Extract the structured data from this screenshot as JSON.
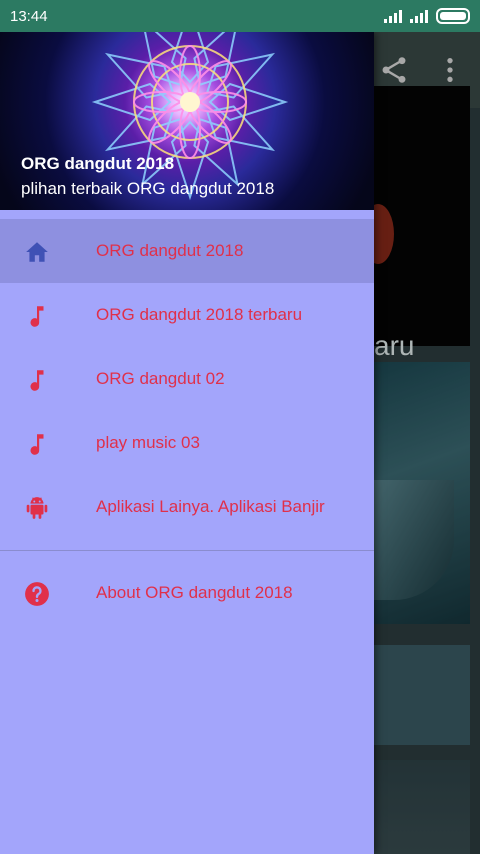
{
  "status_bar": {
    "time": "13:44",
    "signal1_label": "4G",
    "signal2_label": "4G"
  },
  "drawer": {
    "header": {
      "title": "ORG dangdut 2018",
      "subtitle": "plihan terbaik ORG dangdut 2018"
    },
    "items": [
      {
        "label": "ORG dangdut 2018",
        "icon": "home-icon",
        "selected": true
      },
      {
        "label": "ORG dangdut 2018 terbaru",
        "icon": "music-note-icon"
      },
      {
        "label": "ORG dangdut 02",
        "icon": "music-note-icon"
      },
      {
        "label": "play music 03",
        "icon": "music-note-icon"
      },
      {
        "label": "Aplikasi Lainya. Aplikasi Banjir",
        "icon": "android-icon"
      }
    ],
    "secondary_items": [
      {
        "label": "About ORG dangdut 2018",
        "icon": "help-icon"
      }
    ]
  },
  "background": {
    "card_text": "aru"
  },
  "colors": {
    "status_bar": "#2c7a62",
    "drawer_bg": "#a3a5fb",
    "selected_bg": "#8e90e0",
    "label_text": "#e0304a",
    "music_icon": "#e0304a",
    "home_icon": "#3f51b5"
  }
}
